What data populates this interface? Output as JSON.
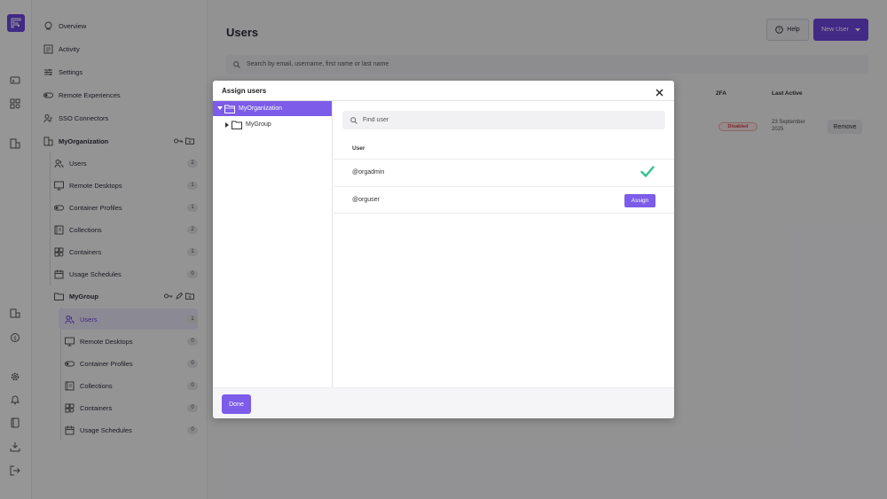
{
  "sidebar": {
    "top": [
      {
        "label": "Overview",
        "icon": "overview-icon"
      },
      {
        "label": "Activity",
        "icon": "activity-icon"
      },
      {
        "label": "Settings",
        "icon": "settings-sliders-icon"
      },
      {
        "label": "Remote Experiences",
        "icon": "toggle-icon"
      },
      {
        "label": "SSO Connectors",
        "icon": "sso-icon"
      }
    ],
    "org": {
      "label": "MyOrganization",
      "items": [
        {
          "label": "Users",
          "count": "2"
        },
        {
          "label": "Remote Desktops",
          "count": "1"
        },
        {
          "label": "Container Profiles",
          "count": "1"
        },
        {
          "label": "Collections",
          "count": "2"
        },
        {
          "label": "Containers",
          "count": "1"
        },
        {
          "label": "Usage Schedules",
          "count": "0"
        }
      ]
    },
    "group": {
      "label": "MyGroup",
      "items": [
        {
          "label": "Users",
          "count": "1"
        },
        {
          "label": "Remote Desktops",
          "count": "0"
        },
        {
          "label": "Container Profiles",
          "count": "0"
        },
        {
          "label": "Collections",
          "count": "0"
        },
        {
          "label": "Containers",
          "count": "0"
        },
        {
          "label": "Usage Schedules",
          "count": "0"
        }
      ]
    }
  },
  "main": {
    "title": "Users",
    "help_label": "Help",
    "new_user_label": "New User",
    "search_placeholder": "Search by email, username, first name or last name",
    "columns": {
      "twofa": "2FA",
      "last_active": "Last Active"
    },
    "row": {
      "status": "Disabled",
      "last_active": "23 September 2025",
      "remove_label": "Remove"
    }
  },
  "modal": {
    "title": "Assign users",
    "tree": [
      {
        "label": "MyOrganization",
        "selected": true
      },
      {
        "label": "MyGroup",
        "selected": false
      }
    ],
    "find_placeholder": "Find user",
    "user_col": "User",
    "users": [
      {
        "name": "@orgadmin",
        "assigned": true
      },
      {
        "name": "@orguser",
        "assigned": false,
        "action": "Assign"
      }
    ],
    "done_label": "Done"
  },
  "colors": {
    "accent": "#6d45e0",
    "accent_light": "#7c5ce8",
    "success": "#2fc48d"
  }
}
